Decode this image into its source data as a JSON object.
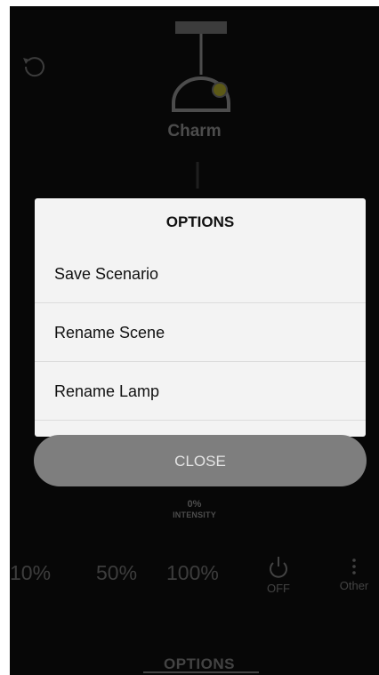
{
  "lamp": {
    "name": "Charm"
  },
  "modal": {
    "title": "OPTIONS",
    "items": [
      {
        "label": "Save Scenario"
      },
      {
        "label": "Rename Scene"
      },
      {
        "label": "Rename Lamp"
      }
    ],
    "close_label": "CLOSE"
  },
  "intensity": {
    "value": "0%",
    "label": "INTENSITY"
  },
  "presets": [
    "10%",
    "50%",
    "100%"
  ],
  "off_label": "OFF",
  "other_label": "Other",
  "bottom_tab": "OPTIONS",
  "icons": {
    "undo": "undo-icon",
    "lamp": "pendant-lamp-icon",
    "power": "power-icon",
    "more": "more-vertical-icon"
  },
  "colors": {
    "background": "#0e0e0e",
    "modal": "#f3f3f3",
    "close_button": "#7e7e7e",
    "lamp_accent": "#a8a229"
  }
}
